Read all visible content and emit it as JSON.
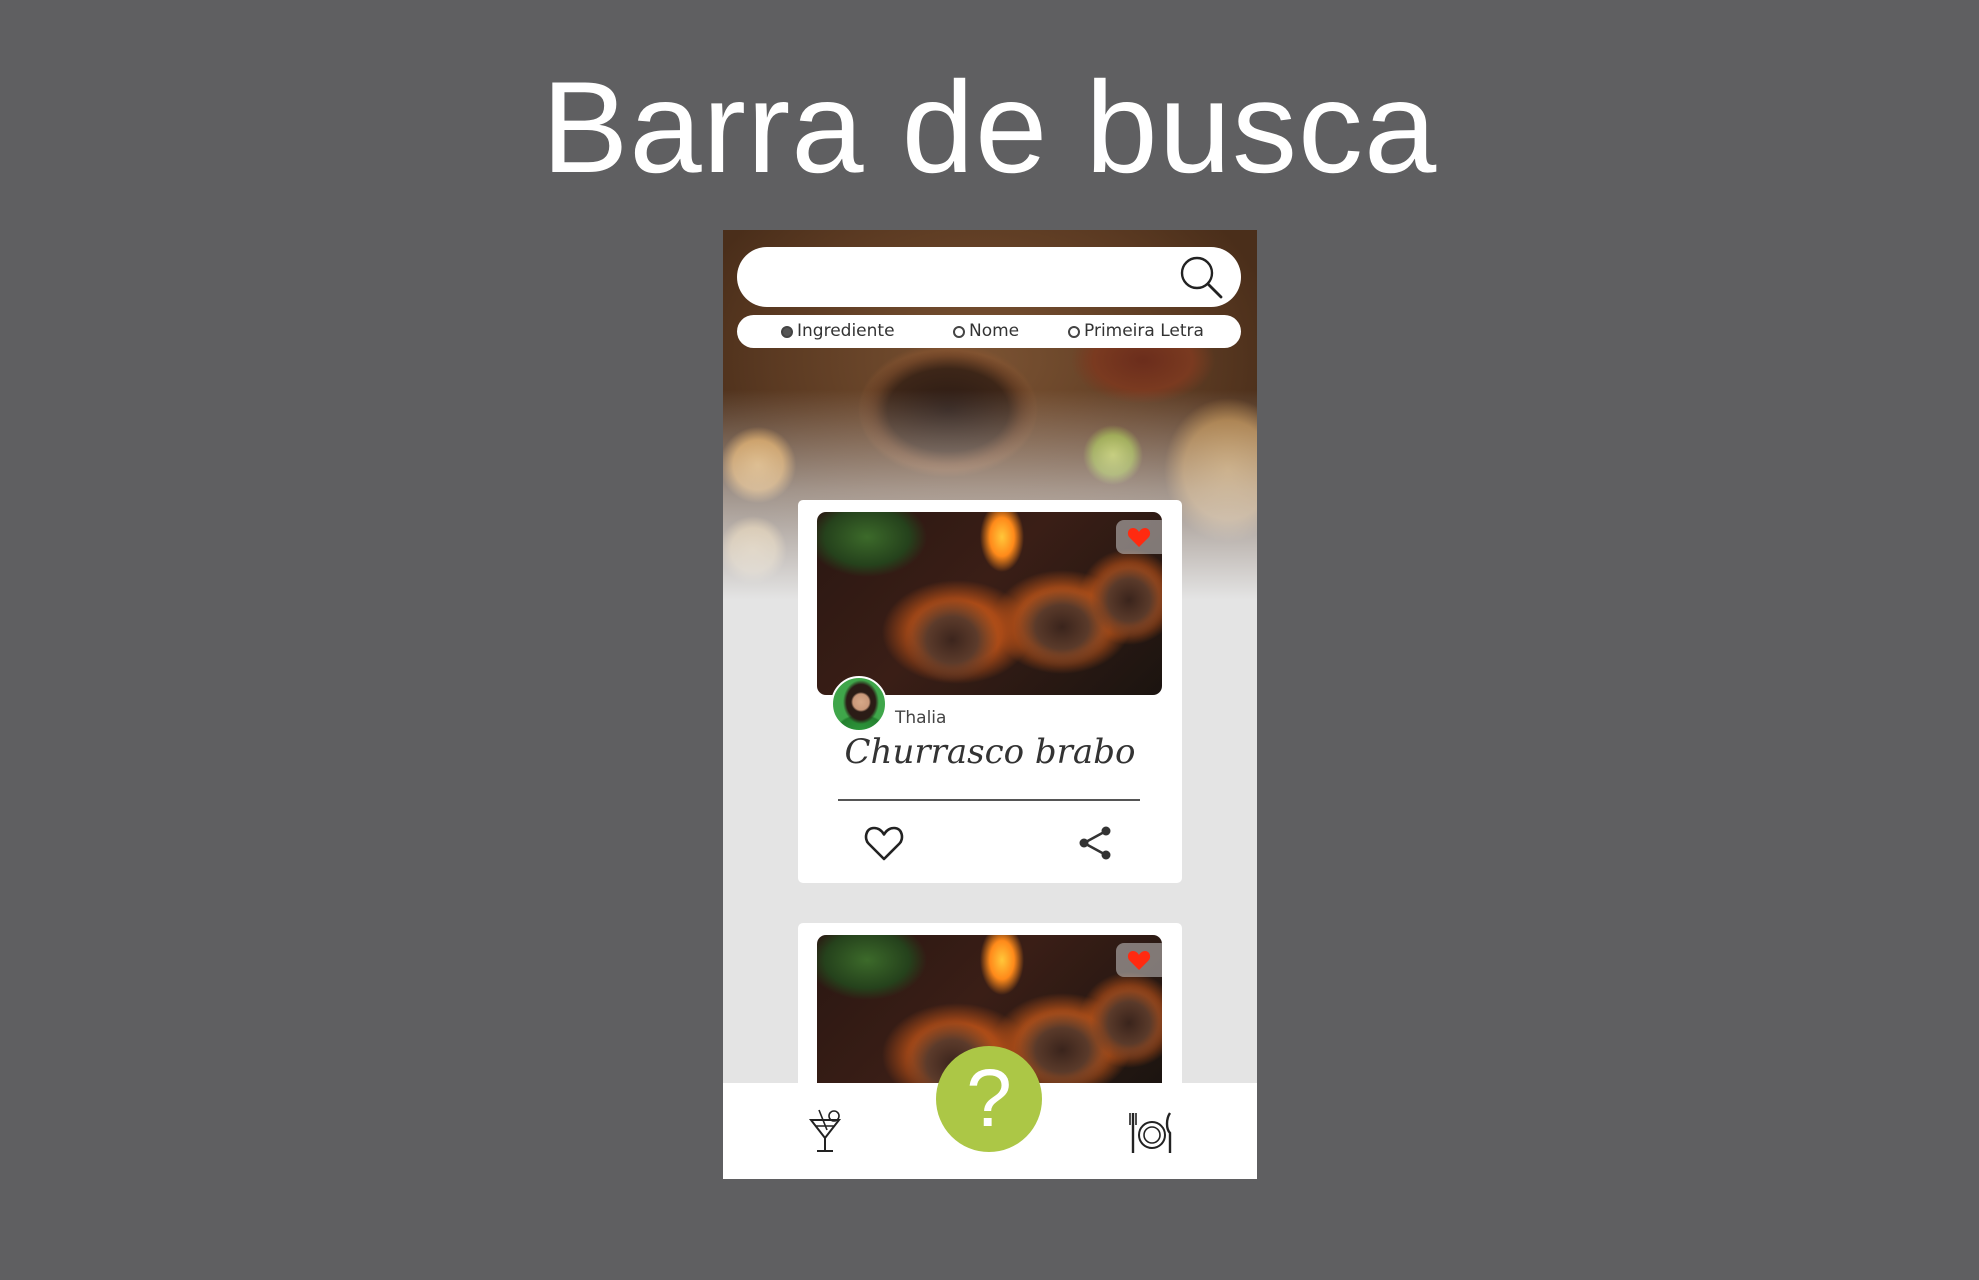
{
  "slide": {
    "title": "Barra de busca"
  },
  "search": {
    "value": "",
    "placeholder": "",
    "icon": "search-icon"
  },
  "filters": {
    "selected": "Ingrediente",
    "options": [
      {
        "label": "Ingrediente",
        "checked": true
      },
      {
        "label": "Nome",
        "checked": false
      },
      {
        "label": "Primeira Letra",
        "checked": false
      }
    ]
  },
  "cards": [
    {
      "author": "Thalia",
      "title": "Churrasco brabo",
      "favorited": true
    },
    {
      "favorited": true
    }
  ],
  "bottom_nav": {
    "left_icon": "drinks-icon",
    "center_label": "?",
    "right_icon": "plate-cutlery-icon"
  },
  "colors": {
    "backdrop": "#5f5f61",
    "accent_green": "#acc746",
    "heart_red": "#ff2a10",
    "app_background": "#e4e4e4"
  }
}
